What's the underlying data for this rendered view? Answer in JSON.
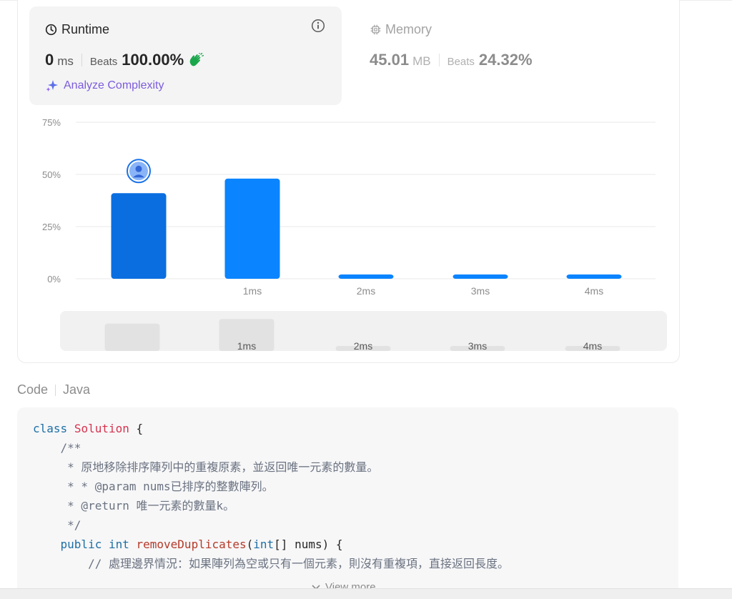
{
  "runtime": {
    "title": "Runtime",
    "value": "0",
    "unit": "ms",
    "beats_label": "Beats",
    "beats_value": "100.00%",
    "analyze_label": "Analyze Complexity",
    "icons": {
      "title": "clock-icon",
      "info": "info-icon",
      "beats_badge": "clap-icon",
      "analyze": "sparkle-icon"
    }
  },
  "memory": {
    "title": "Memory",
    "value": "45.01",
    "unit": "MB",
    "beats_label": "Beats",
    "beats_value": "24.32%",
    "icons": {
      "title": "chip-icon"
    }
  },
  "colors": {
    "bar_selected": "#0a6ee0",
    "bar": "#0a84ff",
    "mini_bar": "#e2e2e2",
    "accent_purple": "#7c5cdb",
    "grid": "#e8e8e8"
  },
  "chart_data": {
    "type": "bar",
    "categories": [
      "",
      "1ms",
      "2ms",
      "3ms",
      "4ms"
    ],
    "values": [
      41,
      48,
      2,
      2,
      2
    ],
    "selected_index": 0,
    "yticks": [
      "75%",
      "50%",
      "25%",
      "0%"
    ],
    "ylim": [
      0,
      75
    ],
    "grid": true,
    "marker": "user-avatar-icon"
  },
  "mini_chart": {
    "categories": [
      "",
      "1ms",
      "2ms",
      "3ms",
      "4ms"
    ],
    "values": [
      41,
      48,
      2,
      2,
      2
    ]
  },
  "code": {
    "label": "Code",
    "language": "Java",
    "view_more": "View more",
    "lines": [
      "class Solution {",
      "    /**",
      "     * 原地移除排序陣列中的重複原素，並返回唯一元素的數量。",
      "     * * @param nums已排序的整數陣列。",
      "     * @return 唯一元素的數量k。",
      "     */",
      "    public int removeDuplicates(int[] nums) {",
      "        // 處理邊界情況：如果陣列為空或只有一個元素，則沒有重複項，直接返回長度。"
    ]
  }
}
